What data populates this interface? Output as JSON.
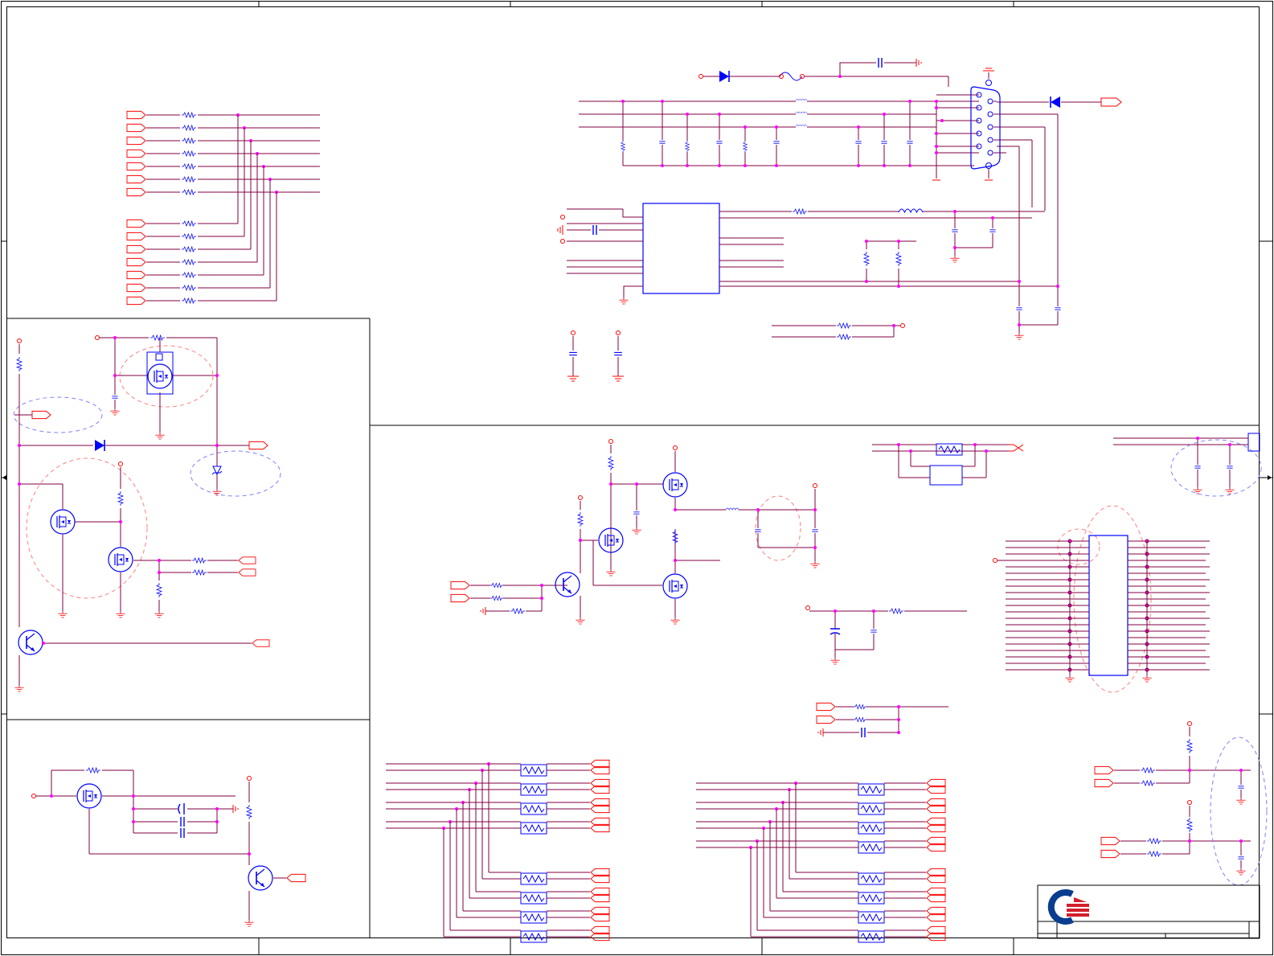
{
  "sheet": {
    "background": "#ffffff",
    "wire_color": "#800040",
    "port_color": "#ff0000",
    "component_color": "#0000ff",
    "junction_color": "#ff00ff",
    "ground_color": "#ff0000",
    "annotation_circle_colors": [
      "#ff8080",
      "#8080ff"
    ]
  },
  "title_block": {
    "logo": "company-logo"
  }
}
